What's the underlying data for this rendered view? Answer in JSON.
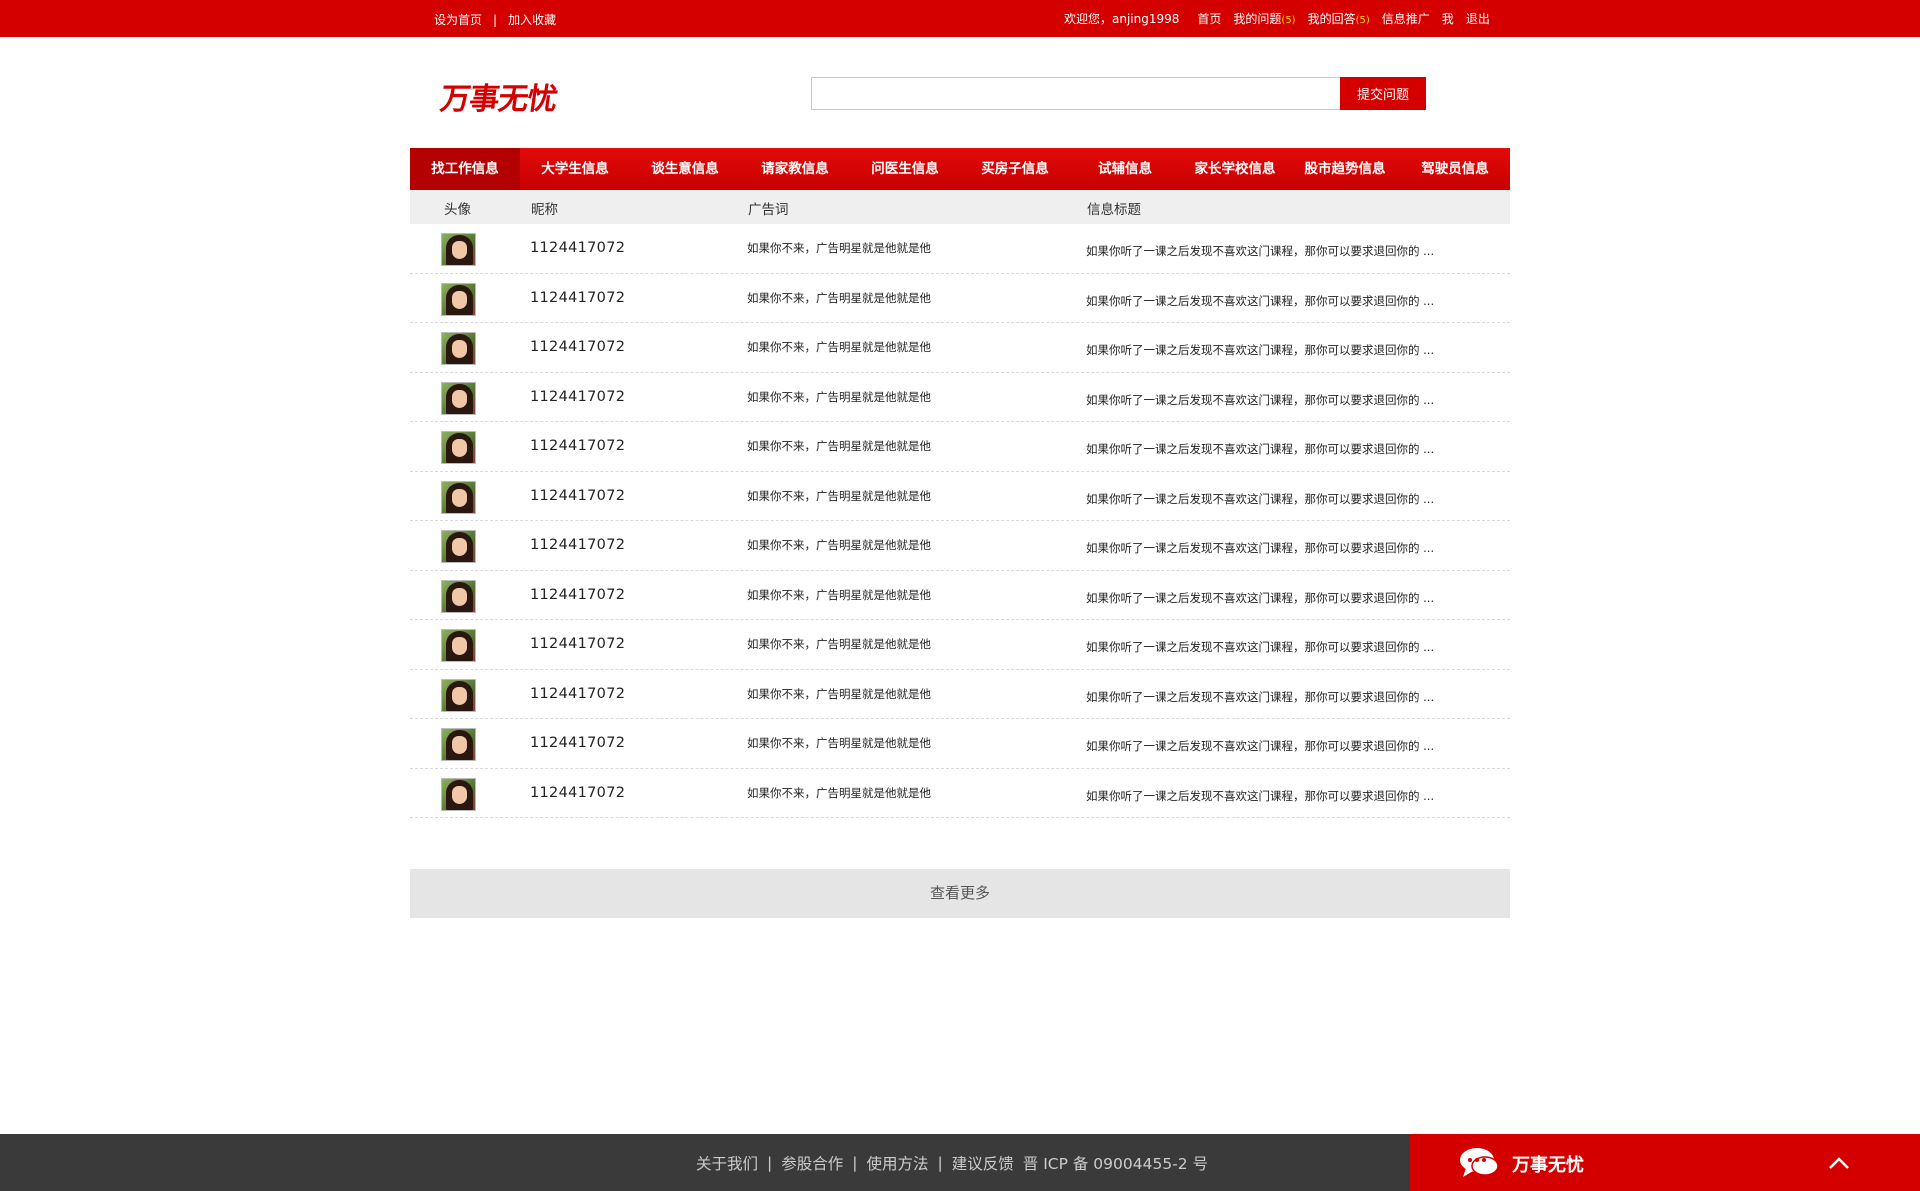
{
  "topbar": {
    "set_home": "设为首页",
    "separator": "|",
    "add_favorite": "加入收藏",
    "welcome": "欢迎您，anjing1998",
    "home": "首页",
    "my_questions": "我的问题",
    "my_questions_count": "(5)",
    "my_answers": "我的回答",
    "my_answers_count": "(5)",
    "promotion": "信息推广",
    "me": "我",
    "logout": "退出"
  },
  "header": {
    "logo": "万事无忧",
    "search_placeholder": "",
    "submit_label": "提交问题"
  },
  "nav": {
    "tabs": [
      {
        "label": "找工作信息",
        "active": true
      },
      {
        "label": "大学生信息"
      },
      {
        "label": "谈生意信息"
      },
      {
        "label": "请家教信息"
      },
      {
        "label": "问医生信息"
      },
      {
        "label": "买房子信息"
      },
      {
        "label": "试辅信息"
      },
      {
        "label": "家长学校信息"
      },
      {
        "label": "股市趋势信息"
      },
      {
        "label": "驾驶员信息"
      }
    ]
  },
  "table": {
    "headers": {
      "avatar": "头像",
      "nickname": "昵称",
      "slogan": "广告词",
      "title": "信息标题"
    },
    "rows": [
      {
        "nickname": "1124417072",
        "slogan": "如果你不来，广告明星就是他就是他",
        "title": "如果你听了一课之后发现不喜欢这门课程，那你可以要求退回你的 ..."
      },
      {
        "nickname": "1124417072",
        "slogan": "如果你不来，广告明星就是他就是他",
        "title": "如果你听了一课之后发现不喜欢这门课程，那你可以要求退回你的 ..."
      },
      {
        "nickname": "1124417072",
        "slogan": "如果你不来，广告明星就是他就是他",
        "title": "如果你听了一课之后发现不喜欢这门课程，那你可以要求退回你的 ..."
      },
      {
        "nickname": "1124417072",
        "slogan": "如果你不来，广告明星就是他就是他",
        "title": "如果你听了一课之后发现不喜欢这门课程，那你可以要求退回你的 ..."
      },
      {
        "nickname": "1124417072",
        "slogan": "如果你不来，广告明星就是他就是他",
        "title": "如果你听了一课之后发现不喜欢这门课程，那你可以要求退回你的 ..."
      },
      {
        "nickname": "1124417072",
        "slogan": "如果你不来，广告明星就是他就是他",
        "title": "如果你听了一课之后发现不喜欢这门课程，那你可以要求退回你的 ..."
      },
      {
        "nickname": "1124417072",
        "slogan": "如果你不来，广告明星就是他就是他",
        "title": "如果你听了一课之后发现不喜欢这门课程，那你可以要求退回你的 ..."
      },
      {
        "nickname": "1124417072",
        "slogan": "如果你不来，广告明星就是他就是他",
        "title": "如果你听了一课之后发现不喜欢这门课程，那你可以要求退回你的 ..."
      },
      {
        "nickname": "1124417072",
        "slogan": "如果你不来，广告明星就是他就是他",
        "title": "如果你听了一课之后发现不喜欢这门课程，那你可以要求退回你的 ..."
      },
      {
        "nickname": "1124417072",
        "slogan": "如果你不来，广告明星就是他就是他",
        "title": "如果你听了一课之后发现不喜欢这门课程，那你可以要求退回你的 ..."
      },
      {
        "nickname": "1124417072",
        "slogan": "如果你不来，广告明星就是他就是他",
        "title": "如果你听了一课之后发现不喜欢这门课程，那你可以要求退回你的 ..."
      },
      {
        "nickname": "1124417072",
        "slogan": "如果你不来，广告明星就是他就是他",
        "title": "如果你听了一课之后发现不喜欢这门课程，那你可以要求退回你的 ..."
      }
    ]
  },
  "more_label": "查看更多",
  "footer": {
    "about": "关于我们",
    "partner": "参股合作",
    "usage": "使用方法",
    "feedback": "建议反馈",
    "icp": "晋 ICP 备 09004455-2 号",
    "pipe": "|",
    "brand": "万事无忧"
  },
  "colors": {
    "brand_red": "#d40000",
    "footer_dark": "#3a3a3a",
    "highlight_count": "#ffd200"
  },
  "icons": {
    "chat": "chat-bubble-icon",
    "back_to_top": "chevron-up-icon"
  }
}
